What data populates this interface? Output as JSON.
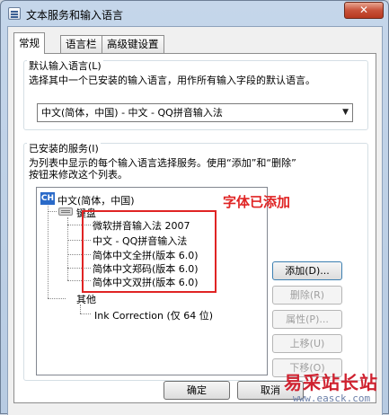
{
  "window": {
    "title": "文本服务和输入语言",
    "close_label": "✕"
  },
  "tabs": [
    {
      "label": "常规"
    },
    {
      "label": "语言栏"
    },
    {
      "label": "高级键设置"
    }
  ],
  "default_input": {
    "group_label": "默认输入语言(L)",
    "description": "选择其中一个已安装的输入语言，用作所有输入字段的默认语言。",
    "selected": "中文(简体，中国) - 中文 - QQ拼音输入法"
  },
  "installed": {
    "group_label": "已安装的服务(I)",
    "description_line1": "为列表中显示的每个输入语言选择服务。使用“添加”和“删除”",
    "description_line2": "按钮来修改这个列表。",
    "language_badge": "CH",
    "language": "中文(简体，中国)",
    "keyboard_label": "键盘",
    "keyboards": [
      "微软拼音输入法 2007",
      "中文 - QQ拼音输入法",
      "简体中文全拼(版本 6.0)",
      "简体中文郑码(版本 6.0)",
      "简体中文双拼(版本 6.0)"
    ],
    "other_label": "其他",
    "other_items": [
      "Ink Correction (仅 64 位)"
    ]
  },
  "side_buttons": {
    "add": "添加(D)...",
    "remove": "删除(R)",
    "properties": "属性(P)...",
    "move_up": "上移(U)",
    "move_down": "下移(O)"
  },
  "footer": {
    "ok": "确定",
    "cancel": "取消"
  },
  "annotation": "字体已添加",
  "watermark": {
    "name": "易采站长站",
    "url": "www.easck.com"
  }
}
